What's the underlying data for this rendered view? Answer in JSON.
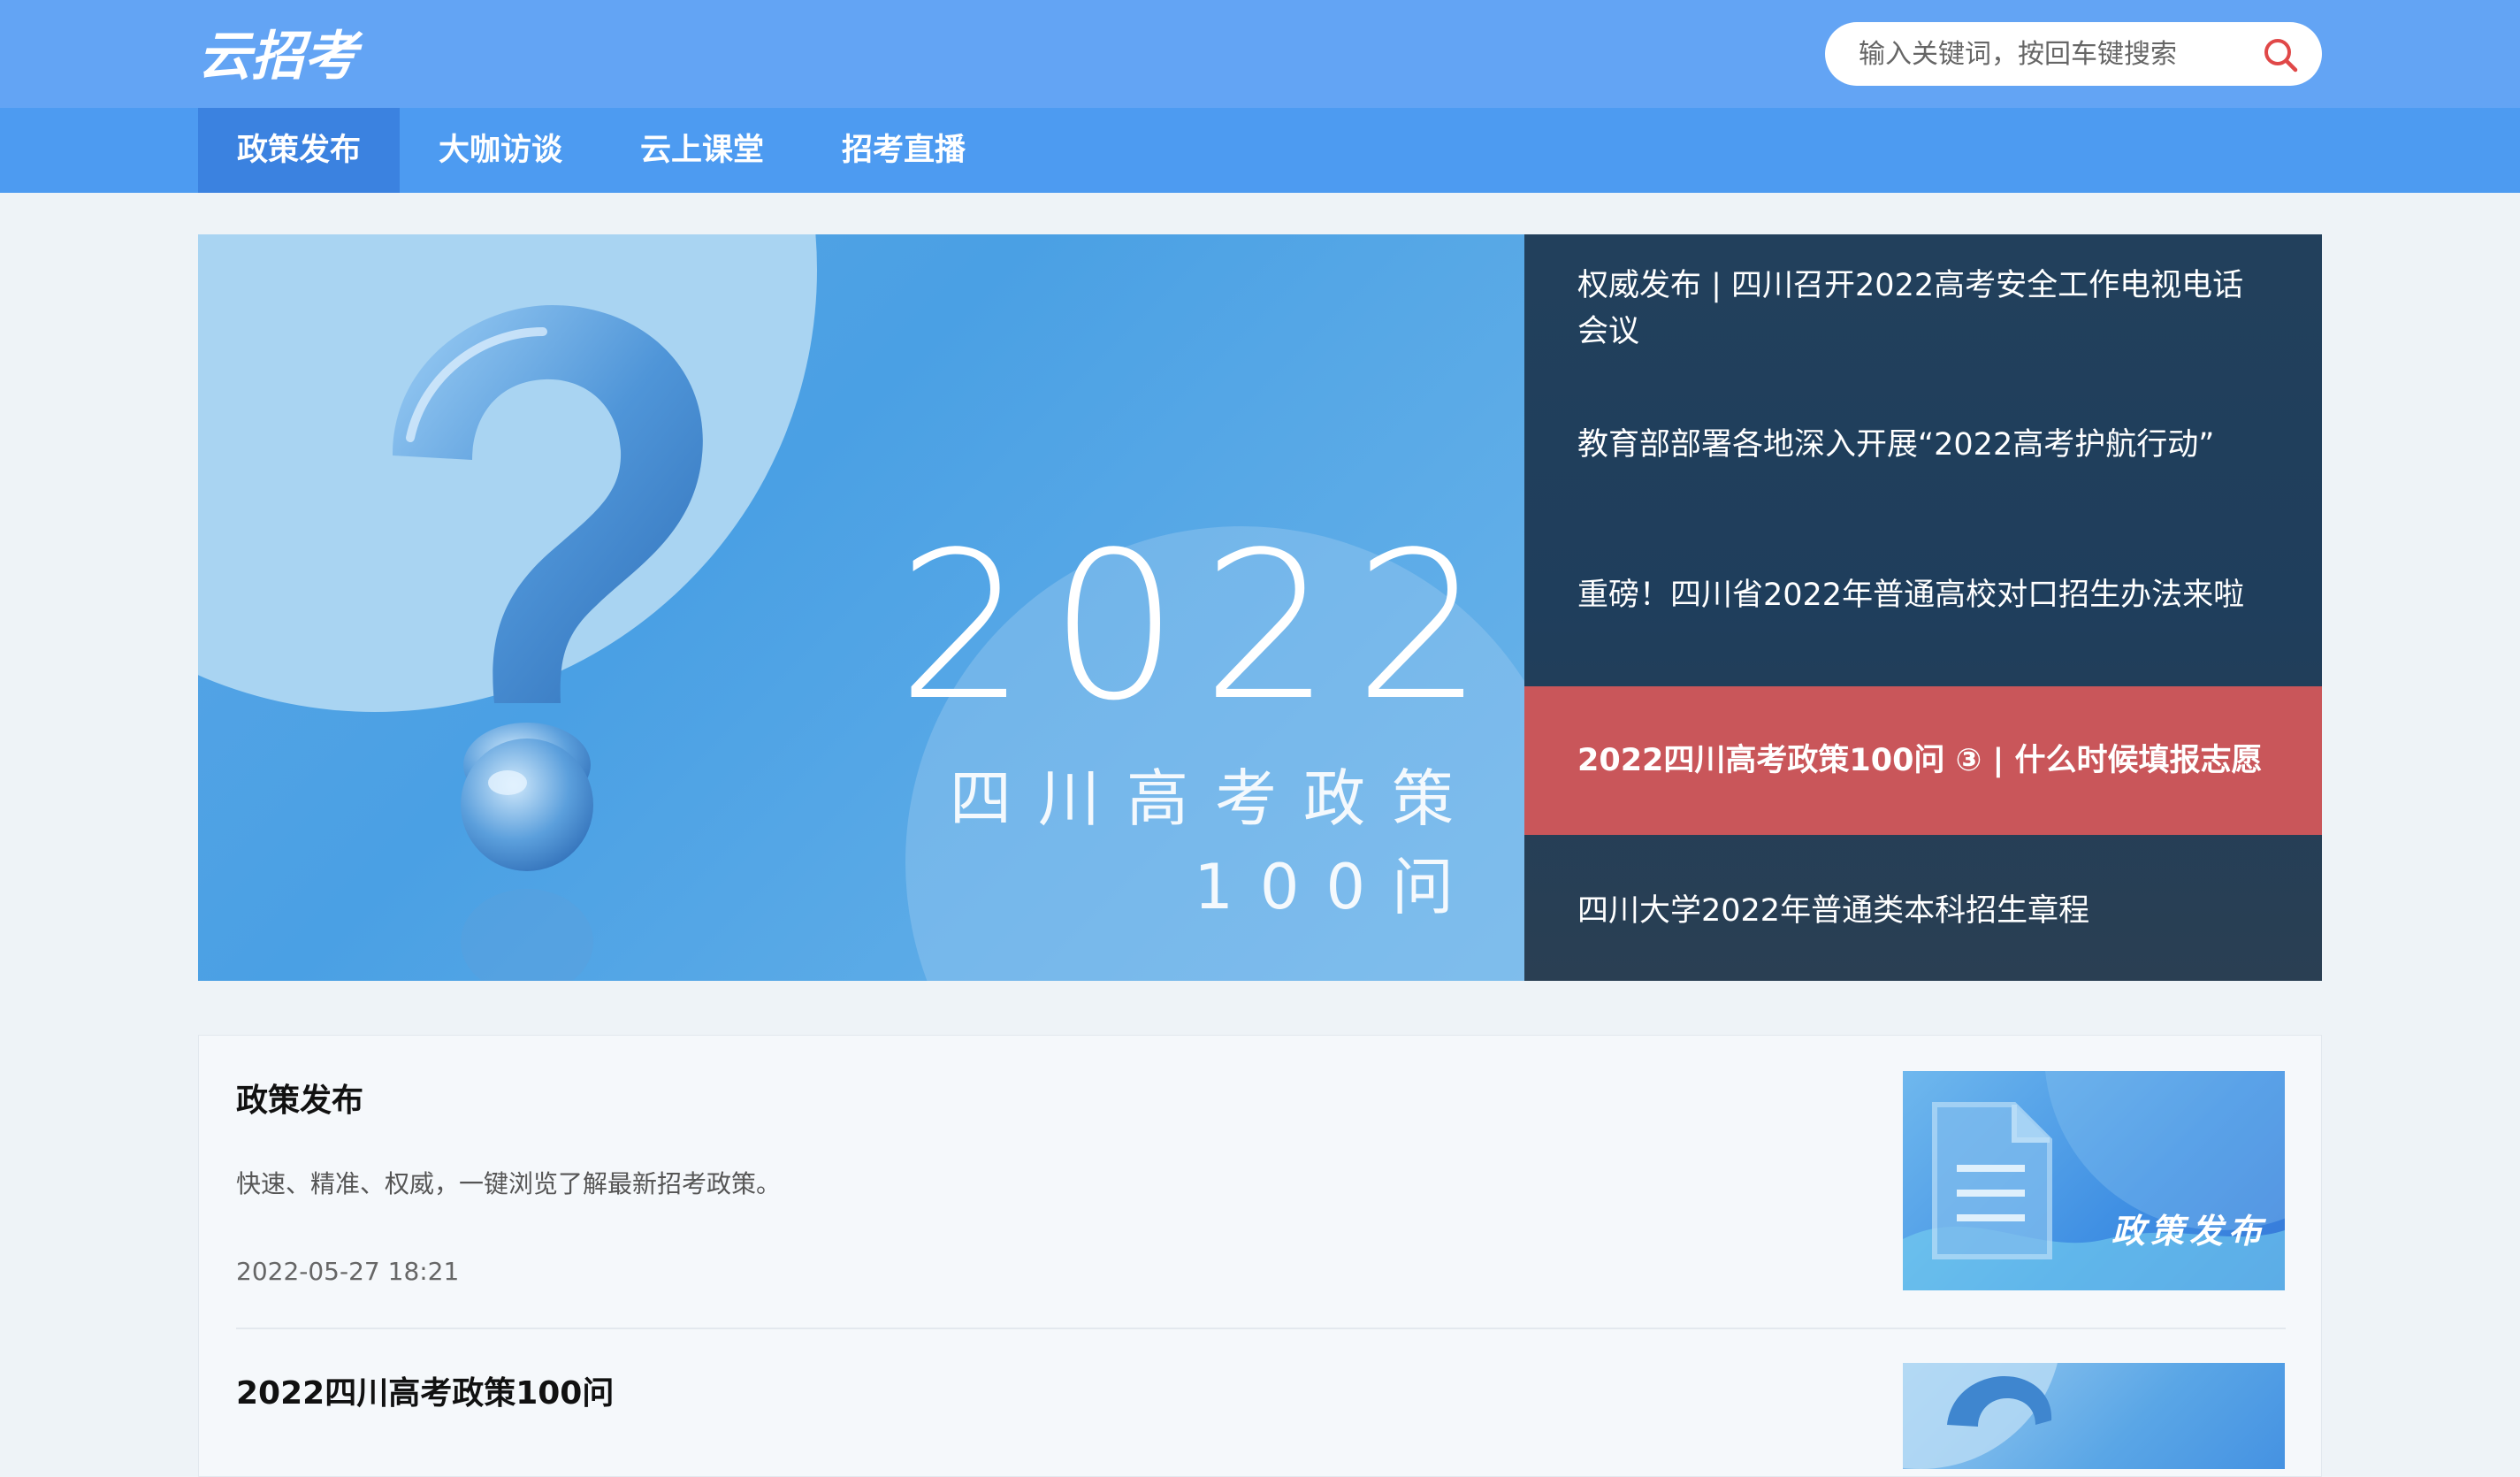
{
  "header": {
    "logo_text": "云招考",
    "search_placeholder": "输入关键词，按回车键搜索"
  },
  "nav": {
    "items": [
      {
        "label": "政策发布",
        "active": true
      },
      {
        "label": "大咖访谈",
        "active": false
      },
      {
        "label": "云上课堂",
        "active": false
      },
      {
        "label": "招考直播",
        "active": false
      }
    ]
  },
  "banner": {
    "year": "2022",
    "subtitle_line1": "四川高考政策",
    "subtitle_line2": "100问",
    "news": [
      {
        "title": "权威发布 | 四川召开2022高考安全工作电视电话会议",
        "highlight": false
      },
      {
        "title": "教育部部署各地深入开展“2022高考护航行动”",
        "highlight": false
      },
      {
        "title": "重磅！四川省2022年普通高校对口招生办法来啦",
        "highlight": false
      },
      {
        "title": "2022四川高考政策100问 ③ | 什么时候填报志愿",
        "highlight": true
      },
      {
        "title": "四川大学2022年普通类本科招生章程",
        "highlight": false
      }
    ]
  },
  "list": {
    "items": [
      {
        "title": "政策发布",
        "desc": "快速、精准、权威，一键浏览了解最新招考政策。",
        "date": "2022-05-27 18:21",
        "thumb_label": "政策发布"
      },
      {
        "title": "2022四川高考政策100问"
      }
    ]
  },
  "colors": {
    "header_bg": "#63a4f4",
    "nav_bg": "#4d9bf1",
    "nav_active": "#3b82e0",
    "news_bg": "#1f3e5c",
    "highlight": "#c9565a"
  },
  "icons": [
    "logo-icon",
    "search-icon",
    "question-mark-icon",
    "document-icon"
  ]
}
